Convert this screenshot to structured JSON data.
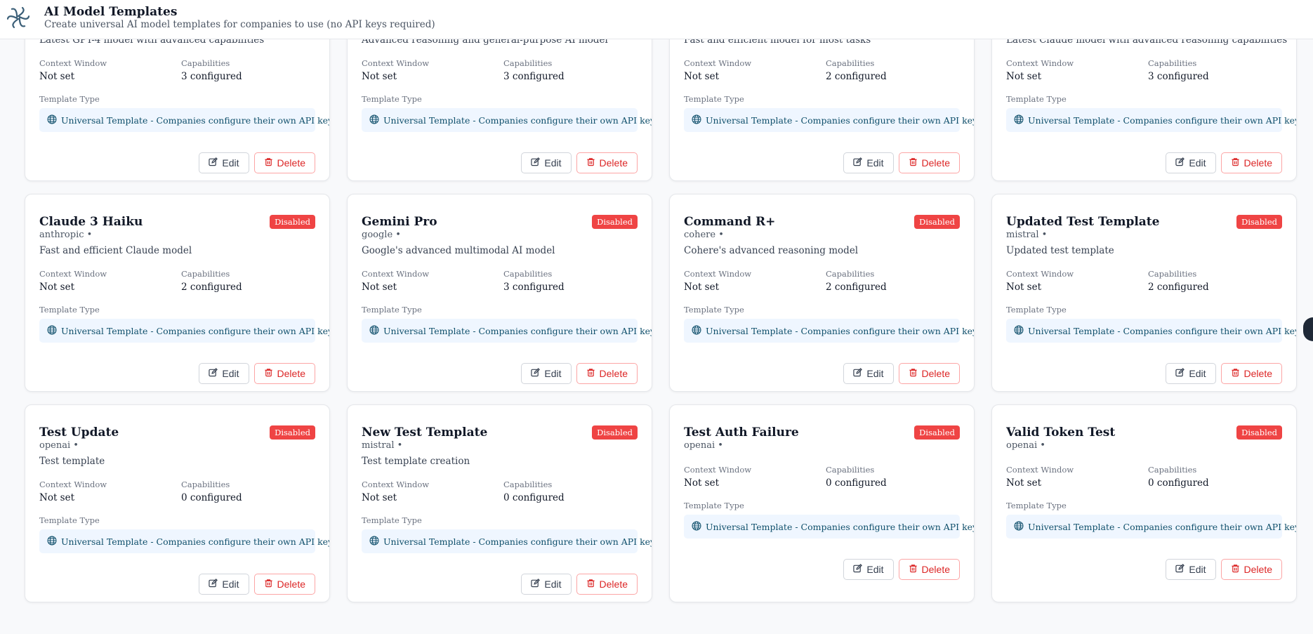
{
  "header": {
    "title": "AI Model Templates",
    "subtitle": "Create universal AI model templates for companies to use (no API keys required)",
    "logo_icon": "pinwheel-logo-icon"
  },
  "labels": {
    "context_window": "Context Window",
    "capabilities": "Capabilities",
    "template_type": "Template Type",
    "template_type_value": "Universal Template - Companies configure their own API keys",
    "edit": "Edit",
    "delete": "Delete"
  },
  "colors": {
    "danger": "#ef4444",
    "accent_bg": "#eff6ff",
    "accent_text": "#0f4f6b"
  },
  "cards": [
    {
      "name": "",
      "provider": "",
      "badge": "",
      "description": "Latest GPT-4 model with advanced capabilities",
      "context_window": "Not set",
      "capabilities": "3 configured"
    },
    {
      "name": "",
      "provider": "",
      "badge": "",
      "description": "Advanced reasoning and general-purpose AI model",
      "context_window": "Not set",
      "capabilities": "3 configured"
    },
    {
      "name": "",
      "provider": "",
      "badge": "",
      "description": "Fast and efficient model for most tasks",
      "context_window": "Not set",
      "capabilities": "2 configured"
    },
    {
      "name": "",
      "provider": "",
      "badge": "",
      "description": "Latest Claude model with advanced reasoning capabilities",
      "context_window": "Not set",
      "capabilities": "3 configured"
    },
    {
      "name": "Claude 3 Haiku",
      "provider": "anthropic •",
      "badge": "Disabled",
      "description": "Fast and efficient Claude model",
      "context_window": "Not set",
      "capabilities": "2 configured"
    },
    {
      "name": "Gemini Pro",
      "provider": "google •",
      "badge": "Disabled",
      "description": "Google's advanced multimodal AI model",
      "context_window": "Not set",
      "capabilities": "3 configured"
    },
    {
      "name": "Command R+",
      "provider": "cohere •",
      "badge": "Disabled",
      "description": "Cohere's advanced reasoning model",
      "context_window": "Not set",
      "capabilities": "2 configured"
    },
    {
      "name": "Updated Test Template",
      "provider": "mistral •",
      "badge": "Disabled",
      "description": "Updated test template",
      "context_window": "Not set",
      "capabilities": "2 configured"
    },
    {
      "name": "Test Update",
      "provider": "openai •",
      "badge": "Disabled",
      "description": "Test template",
      "context_window": "Not set",
      "capabilities": "0 configured"
    },
    {
      "name": "New Test Template",
      "provider": "mistral •",
      "badge": "Disabled",
      "description": "Test template creation",
      "context_window": "Not set",
      "capabilities": "0 configured"
    },
    {
      "name": "Test Auth Failure",
      "provider": "openai •",
      "badge": "Disabled",
      "description": "",
      "context_window": "Not set",
      "capabilities": "0 configured"
    },
    {
      "name": "Valid Token Test",
      "provider": "openai •",
      "badge": "Disabled",
      "description": "",
      "context_window": "Not set",
      "capabilities": "0 configured"
    }
  ]
}
